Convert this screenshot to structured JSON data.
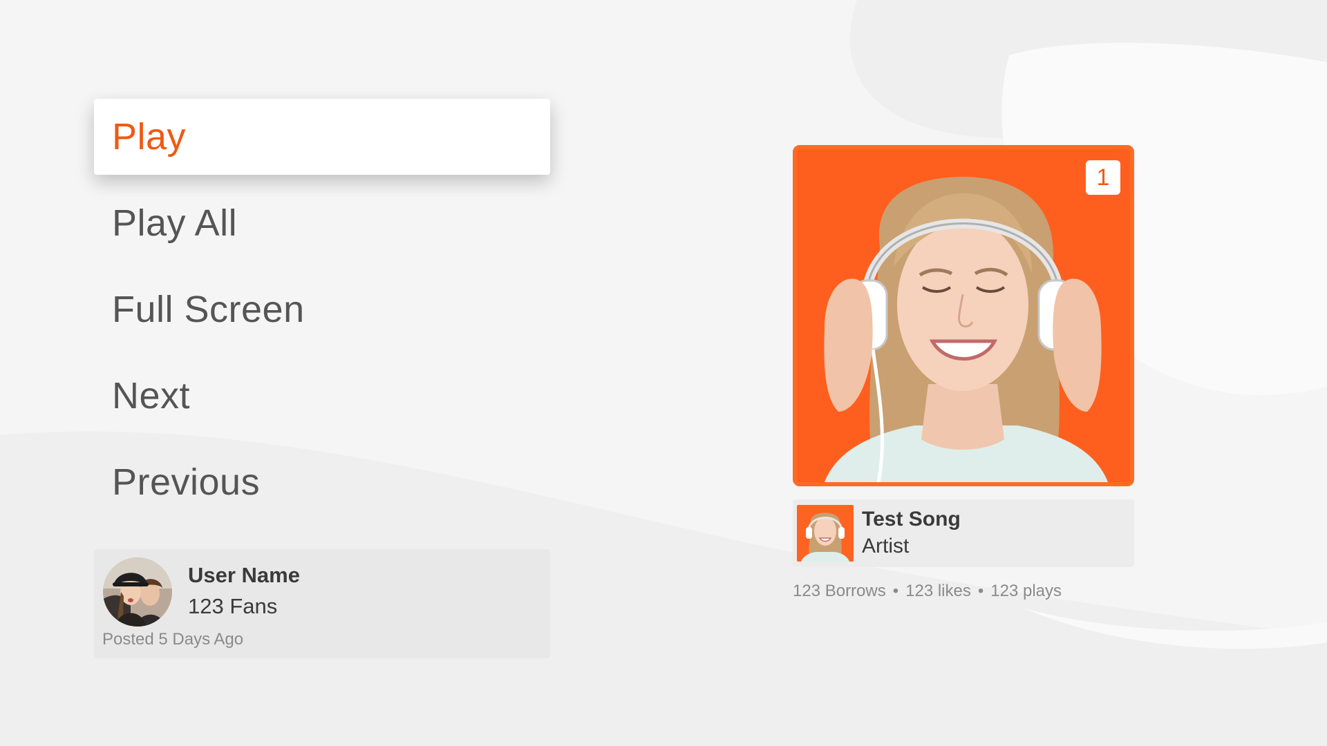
{
  "menu": {
    "items": [
      {
        "label": "Play"
      },
      {
        "label": "Play All"
      },
      {
        "label": "Full Screen"
      },
      {
        "label": "Next"
      },
      {
        "label": "Previous"
      }
    ]
  },
  "user": {
    "name": "User Name",
    "fans": "123 Fans",
    "posted": "Posted 5 Days Ago"
  },
  "song": {
    "badge": "1",
    "title": "Test Song",
    "artist": "Artist",
    "stats": {
      "borrows": "123 Borrows",
      "likes": "123 likes",
      "plays": "123 plays",
      "separator": "•"
    }
  },
  "colors": {
    "accent": "#ef5a14",
    "album_background": "#ff6524",
    "page_background": "#f5f5f5",
    "menu_text": "#555555"
  }
}
